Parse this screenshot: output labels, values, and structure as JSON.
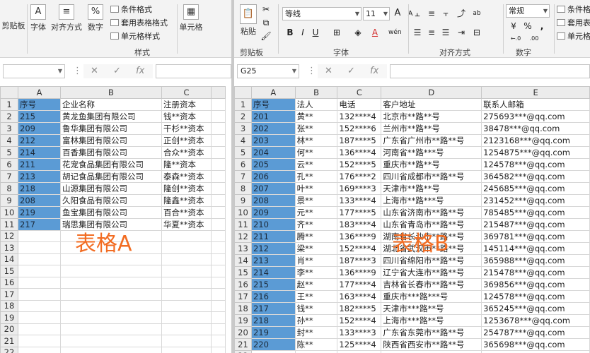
{
  "left": {
    "ribbon": {
      "clipboard": "剪贴板",
      "font": "字体",
      "align": "对齐方式",
      "number": "数字",
      "cond_format": "条件格式",
      "table_format": "套用表格格式",
      "cell_style": "单元格样式",
      "cell": "单元格",
      "styles_group": "样式",
      "font_icon": "A",
      "number_icon": "%"
    },
    "namebox": "",
    "fx": "fx",
    "columns": [
      "A",
      "B",
      "C"
    ],
    "rows": [
      [
        "序号",
        "企业名称",
        "注册资本"
      ],
      [
        "215",
        "黄龙鱼集团有限公司",
        "钱**资本"
      ],
      [
        "209",
        "鲁华集团有限公司",
        "干杉**资本"
      ],
      [
        "212",
        "富林集团有限公司",
        "正创**资本"
      ],
      [
        "214",
        "百香集团有限公司",
        "合众**资本"
      ],
      [
        "211",
        "花宠食品集团有限公司",
        "隆**资本"
      ],
      [
        "213",
        "胡记食品集团有限公司",
        "泰森**资本"
      ],
      [
        "218",
        "山源集团有限公司",
        "隆创**资本"
      ],
      [
        "208",
        "久阳食品有限公司",
        "隆鑫**资本"
      ],
      [
        "219",
        "鱼宝集团有限公司",
        "百合**资本"
      ],
      [
        "217",
        "瑞思集团有限公司",
        "华夏**资本"
      ],
      [
        "",
        "",
        ""
      ],
      [
        "",
        "",
        ""
      ],
      [
        "",
        "",
        ""
      ],
      [
        "",
        "",
        ""
      ],
      [
        "",
        "",
        ""
      ],
      [
        "",
        "",
        ""
      ],
      [
        "",
        "",
        ""
      ],
      [
        "",
        "",
        ""
      ],
      [
        "",
        "",
        ""
      ],
      [
        "",
        "",
        ""
      ],
      [
        "",
        "",
        ""
      ]
    ],
    "overlay": "表格A"
  },
  "right": {
    "ribbon": {
      "font_name": "等线",
      "font_size": "11",
      "number_format": "常规",
      "paste": "粘贴",
      "clipboard": "剪贴板",
      "font": "字体",
      "align": "对齐方式",
      "number": "数字",
      "cond_format": "条件格式",
      "table_format": "套用表",
      "cell_style": "单元格",
      "bold": "B",
      "italic": "I",
      "underline": "U",
      "grow_font": "A",
      "shrink_font": "A",
      "font_color_icon": "A",
      "phonetic": "wén",
      "wrap_icon": "ab",
      "currency_icon": "¥",
      "percent_icon": "%",
      "comma_icon": ",",
      "inc_decimal": "←.0",
      "dec_decimal": ".00"
    },
    "namebox": "G25",
    "fx": "fx",
    "columns": [
      "A",
      "B",
      "C",
      "D",
      "E"
    ],
    "rows": [
      [
        "序号",
        "法人",
        "电话",
        "客户地址",
        "联系人邮箱"
      ],
      [
        "201",
        "黄**",
        "132****4",
        "北京市**路**号",
        "275693***@qq.com"
      ],
      [
        "202",
        "张**",
        "152****6",
        "兰州市**路**号",
        "38478***@qq.com"
      ],
      [
        "203",
        "林**",
        "187****5",
        "广东省广州市**路**号",
        "2123168***@qq.com"
      ],
      [
        "204",
        "何**",
        "136****4",
        "河南省**路***号",
        "1254875***@qq.com"
      ],
      [
        "205",
        "云**",
        "152****5",
        "重庆市**路**号",
        "124578***@qq.com"
      ],
      [
        "206",
        "孔**",
        "176****2",
        "四川省成都市**路**号",
        "364582***@qq.com"
      ],
      [
        "207",
        "叶**",
        "169****3",
        "天津市**路**号",
        "245685***@qq.com"
      ],
      [
        "208",
        "景**",
        "133****4",
        "上海市**路***号",
        "231452***@qq.com"
      ],
      [
        "209",
        "元**",
        "177****5",
        "山东省济南市**路**号",
        "785485***@qq.com"
      ],
      [
        "210",
        "齐**",
        "183****4",
        "山东省青岛市**路**号",
        "215487***@qq.com"
      ],
      [
        "211",
        "腾**",
        "136****9",
        "湖南省长沙市**路**号",
        "369781***@qq.com"
      ],
      [
        "212",
        "梁**",
        "152****4",
        "湖北省武汉市**路**号",
        "145114***@qq.com"
      ],
      [
        "213",
        "肖**",
        "187****3",
        "四川省绵阳市**路**号",
        "365988***@qq.com"
      ],
      [
        "214",
        "李**",
        "136****9",
        "辽宁省大连市**路**号",
        "215478***@qq.com"
      ],
      [
        "215",
        "赵**",
        "177****4",
        "吉林省长春市**路**号",
        "369856***@qq.com"
      ],
      [
        "216",
        "王**",
        "163****4",
        "重庆市***路***号",
        "124578***@qq.com"
      ],
      [
        "217",
        "钱**",
        "182****5",
        "天津市***路**号",
        "365245***@qq.com"
      ],
      [
        "218",
        "孙**",
        "152****4",
        "上海市***路**号",
        "1253678***@qq.com"
      ],
      [
        "219",
        "封**",
        "133****3",
        "广东省东莞市**路**号",
        "254787***@qq.com"
      ],
      [
        "220",
        "陈**",
        "125****4",
        "陕西省西安市**路**号",
        "365698***@qq.com"
      ],
      [
        "",
        "",
        "",
        "",
        ""
      ]
    ],
    "overlay": "表格B"
  }
}
